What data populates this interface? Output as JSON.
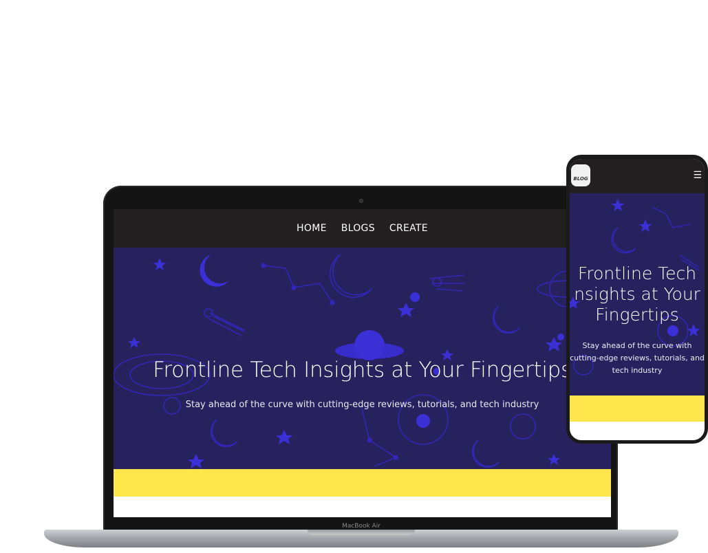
{
  "desktop": {
    "nav": {
      "items": [
        "HOME",
        "BLOGS",
        "CREATE"
      ]
    },
    "hero": {
      "title": "Frontline Tech Insights at Your Fingertips",
      "subtitle": "Stay ahead of the curve with cutting-edge reviews, tutorials, and tech industry"
    },
    "device_label": "MacBook Air"
  },
  "mobile": {
    "logo_text": "BLOG",
    "menu_icon": "☰",
    "hero": {
      "title_lines": [
        "Frontline Tech",
        "nsights at Your",
        "Fingertips"
      ],
      "subtitle_lines": [
        "Stay ahead of the curve with",
        "cutting-edge reviews, tutorials, and",
        "tech industry"
      ]
    }
  },
  "colors": {
    "nav_bg": "#231f20",
    "hero_bg": "#27215e",
    "doodle": "#3b2fd6",
    "band": "#fde74c"
  }
}
